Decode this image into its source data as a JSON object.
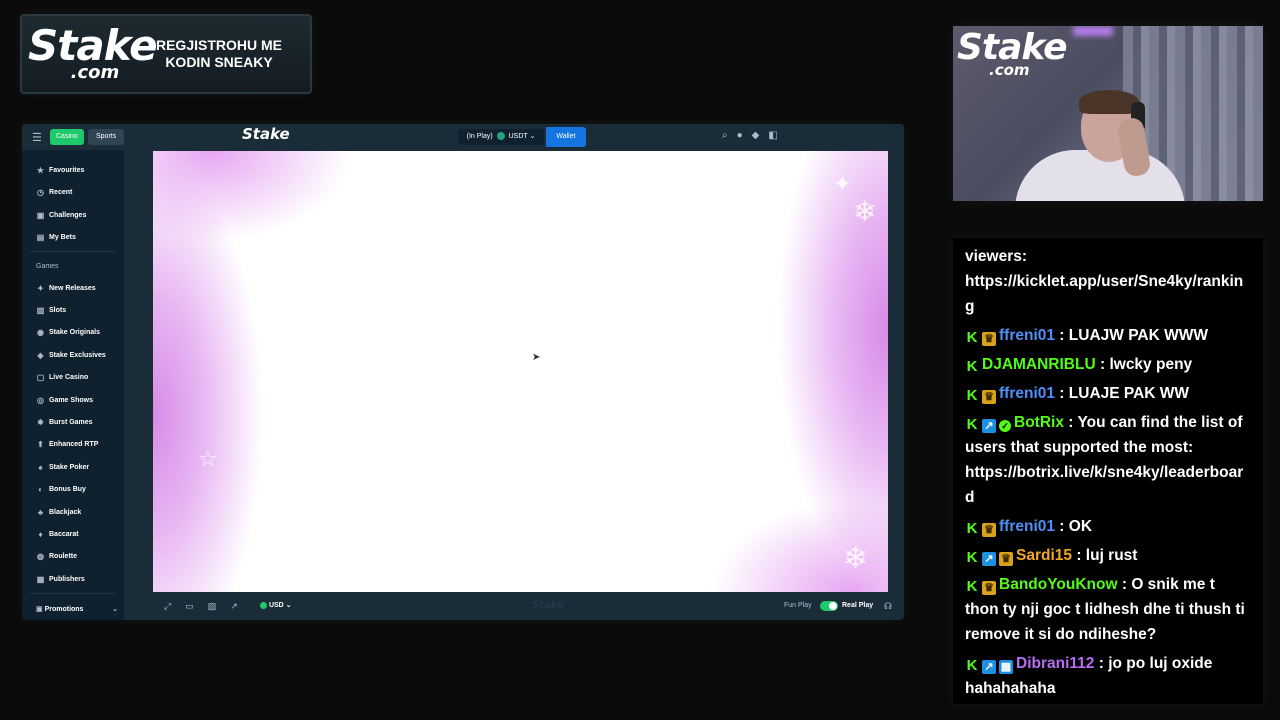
{
  "banner": {
    "logo_main": "Stake",
    "logo_sub": ".com",
    "text": "REGJISTROHU ME KODIN SNEAKY"
  },
  "topbar": {
    "casino_tab": "Casino",
    "sports_tab": "Sports",
    "logo": "Stake",
    "balance_label": "(In Play)",
    "balance_currency": "USDT",
    "wallet_button": "Wallet"
  },
  "sidebar": {
    "items_top": [
      {
        "label": "Favourites",
        "icon": "star-icon"
      },
      {
        "label": "Recent",
        "icon": "clock-icon"
      },
      {
        "label": "Challenges",
        "icon": "trophy-icon"
      },
      {
        "label": "My Bets",
        "icon": "bets-icon"
      }
    ],
    "games_section": "Games",
    "games_items": [
      {
        "label": "New Releases",
        "icon": "sparkle-icon"
      },
      {
        "label": "Slots",
        "icon": "slots-icon"
      },
      {
        "label": "Stake Originals",
        "icon": "originals-icon"
      },
      {
        "label": "Stake Exclusives",
        "icon": "exclusives-icon"
      },
      {
        "label": "Live Casino",
        "icon": "live-icon"
      },
      {
        "label": "Game Shows",
        "icon": "gameshow-icon"
      },
      {
        "label": "Burst Games",
        "icon": "burst-icon"
      },
      {
        "label": "Enhanced RTP",
        "icon": "rtp-icon"
      },
      {
        "label": "Stake Poker",
        "icon": "poker-icon"
      },
      {
        "label": "Bonus Buy",
        "icon": "bonus-icon"
      },
      {
        "label": "Blackjack",
        "icon": "blackjack-icon"
      },
      {
        "label": "Baccarat",
        "icon": "baccarat-icon"
      },
      {
        "label": "Roulette",
        "icon": "roulette-icon"
      },
      {
        "label": "Publishers",
        "icon": "publishers-icon"
      }
    ],
    "promotions": "Promotions"
  },
  "bottombar": {
    "currency": "USD",
    "fun_play": "Fun Play",
    "real_play": "Real Play",
    "real_play_enabled": true
  },
  "webcam": {
    "logo_main": "Stake",
    "logo_sub": ".com"
  },
  "chat": {
    "messages": [
      {
        "badges": [],
        "user": "",
        "user_color": "#ffffff",
        "text": "viewers: https://kicklet.app/user/Sne4ky/ranking"
      },
      {
        "badges": [
          "kick",
          "crown"
        ],
        "user": "ffreni01",
        "user_color": "#4f8ff7",
        "text": "LUAJW PAK WWW"
      },
      {
        "badges": [
          "kick"
        ],
        "user": "DJAMANRIBLU",
        "user_color": "#53fc18",
        "text": "lwcky peny"
      },
      {
        "badges": [
          "kick",
          "crown"
        ],
        "user": "ffreni01",
        "user_color": "#4f8ff7",
        "text": "LUAJE PAK WW"
      },
      {
        "badges": [
          "kick",
          "bot",
          "verified"
        ],
        "user": "BotRix",
        "user_color": "#53fc18",
        "text": "You can find the list of users that supported the most: https://botrix.live/k/sne4ky/leaderboard"
      },
      {
        "badges": [
          "kick",
          "crown"
        ],
        "user": "ffreni01",
        "user_color": "#4f8ff7",
        "text": "OK"
      },
      {
        "badges": [
          "kick",
          "bot",
          "crown"
        ],
        "user": "Sardi15",
        "user_color": "#f5a623",
        "text": "luj rust"
      },
      {
        "badges": [
          "kick",
          "crown"
        ],
        "user": "BandoYouKnow",
        "user_color": "#53fc18",
        "text": "O snik me t thon ty nji goc t lidhesh dhe ti thush ti remove it si do ndiheshe?"
      },
      {
        "badges": [
          "kick",
          "bot",
          "ultra"
        ],
        "user": "Dibrani112",
        "user_color": "#b86cf2",
        "text": "jo po luj oxide hahahahaha"
      }
    ]
  }
}
